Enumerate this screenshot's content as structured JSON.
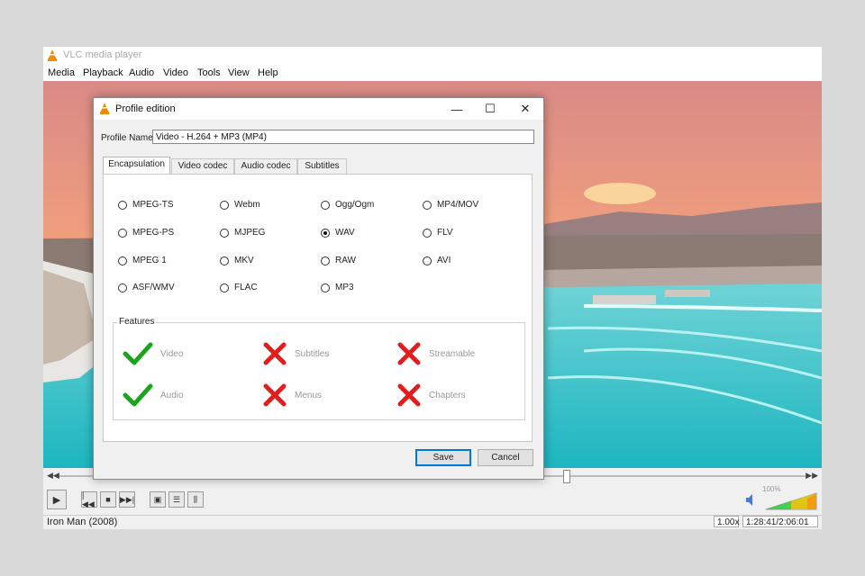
{
  "app": {
    "title": "VLC media player"
  },
  "menu": [
    "Media",
    "Playback",
    "Audio",
    "Video",
    "Tools",
    "View",
    "Help"
  ],
  "dialog": {
    "title": "Profile edition",
    "profile_name_label": "Profile Name",
    "profile_name_value": "Video - H.264 + MP3 (MP4)",
    "tabs": [
      "Encapsulation",
      "Video codec",
      "Audio codec",
      "Subtitles"
    ],
    "active_tab": "Encapsulation",
    "formats": [
      "MPEG-TS",
      "Webm",
      "Ogg/Ogm",
      "MP4/MOV",
      "MPEG-PS",
      "MJPEG",
      "WAV",
      "FLV",
      "MPEG 1",
      "MKV",
      "RAW",
      "AVI",
      "ASF/WMV",
      "FLAC",
      "MP3"
    ],
    "selected_format": "WAV",
    "features_label": "Features",
    "features": [
      {
        "label": "Video",
        "enabled": true
      },
      {
        "label": "Subtitles",
        "enabled": false
      },
      {
        "label": "Streamable",
        "enabled": false
      },
      {
        "label": "Audio",
        "enabled": true
      },
      {
        "label": "Menus",
        "enabled": false
      },
      {
        "label": "Chapters",
        "enabled": false
      }
    ],
    "save_label": "Save",
    "cancel_label": "Cancel"
  },
  "player": {
    "seek_progress": 0.68,
    "volume_percent": "100%",
    "media_title": "Iron Man (2008)",
    "speed": "1.00x",
    "time": "1:28:41/2:06:01"
  },
  "colors": {
    "check": "#1aa61a",
    "cross": "#e11d1d",
    "accent": "#0078d7",
    "vlc_orange": "#f28a00"
  }
}
